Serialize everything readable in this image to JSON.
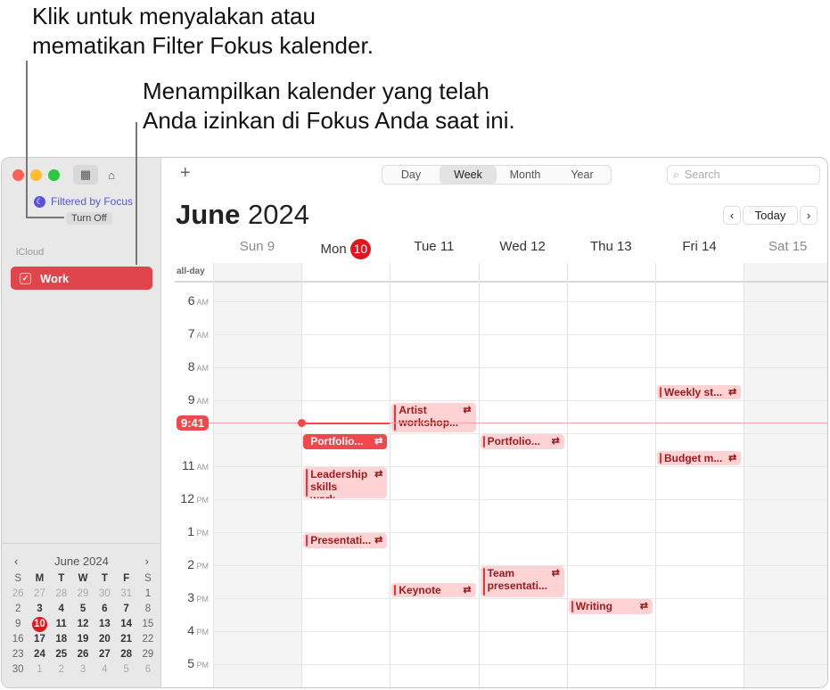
{
  "callouts": [
    "Klik untuk menyalakan atau",
    "mematikan Filter Fokus kalender.",
    "Menampilkan kalender yang telah",
    "Anda izinkan di Fokus Anda saat ini."
  ],
  "sidebar": {
    "focus_label": "Filtered by Focus",
    "turn_off": "Turn Off",
    "group": "iCloud",
    "calendars": [
      {
        "label": "Work",
        "checked": true,
        "color": "#e0454b"
      }
    ]
  },
  "mini_calendar": {
    "title": "June 2024",
    "weekdays": [
      "S",
      "M",
      "T",
      "W",
      "T",
      "F",
      "S"
    ],
    "weeks": [
      [
        "26",
        "27",
        "28",
        "29",
        "30",
        "31",
        "1"
      ],
      [
        "2",
        "3",
        "4",
        "5",
        "6",
        "7",
        "8"
      ],
      [
        "9",
        "10",
        "11",
        "12",
        "13",
        "14",
        "15"
      ],
      [
        "16",
        "17",
        "18",
        "19",
        "20",
        "21",
        "22"
      ],
      [
        "23",
        "24",
        "25",
        "26",
        "27",
        "28",
        "29"
      ],
      [
        "30",
        "1",
        "2",
        "3",
        "4",
        "5",
        "6"
      ]
    ],
    "today": "10"
  },
  "toolbar": {
    "views": [
      "Day",
      "Week",
      "Month",
      "Year"
    ],
    "active_view": "Week",
    "search_placeholder": "Search",
    "today": "Today"
  },
  "header": {
    "month": "June",
    "year": "2024"
  },
  "days": [
    {
      "name": "Sun",
      "num": "9"
    },
    {
      "name": "Mon",
      "num": "10",
      "today": true
    },
    {
      "name": "Tue",
      "num": "11"
    },
    {
      "name": "Wed",
      "num": "12"
    },
    {
      "name": "Thu",
      "num": "13"
    },
    {
      "name": "Fri",
      "num": "14"
    },
    {
      "name": "Sat",
      "num": "15"
    }
  ],
  "all_day_label": "all-day",
  "hours": [
    {
      "h": "6",
      "ap": "AM"
    },
    {
      "h": "7",
      "ap": "AM"
    },
    {
      "h": "8",
      "ap": "AM"
    },
    {
      "h": "9",
      "ap": "AM"
    },
    {
      "h": "10",
      "ap": "AM"
    },
    {
      "h": "11",
      "ap": "AM"
    },
    {
      "h": "12",
      "ap": "PM"
    },
    {
      "h": "1",
      "ap": "PM"
    },
    {
      "h": "2",
      "ap": "PM"
    },
    {
      "h": "3",
      "ap": "PM"
    },
    {
      "h": "4",
      "ap": "PM"
    },
    {
      "h": "5",
      "ap": "PM"
    }
  ],
  "current_time": "9:41",
  "events": [
    {
      "title": "Weekly st...",
      "day": 5,
      "start": 8.5,
      "end": 9.0
    },
    {
      "title": "Artist workshop...",
      "day": 2,
      "start": 9.05,
      "end": 10.0
    },
    {
      "title": "Portfolio...",
      "day": 1,
      "start": 10.0,
      "end": 10.5,
      "selected": true
    },
    {
      "title": "Portfolio...",
      "day": 3,
      "start": 10.0,
      "end": 10.5
    },
    {
      "title": "Budget m...",
      "day": 5,
      "start": 10.5,
      "end": 11.0
    },
    {
      "title": "Leadership skills work...",
      "day": 1,
      "start": 11.0,
      "end": 12.0
    },
    {
      "title": "Presentati...",
      "day": 1,
      "start": 13.0,
      "end": 13.5
    },
    {
      "title": "Team presentati...",
      "day": 3,
      "start": 14.0,
      "end": 15.0
    },
    {
      "title": "Keynote b...",
      "day": 2,
      "start": 14.5,
      "end": 15.0
    },
    {
      "title": "Writing se...",
      "day": 4,
      "start": 15.0,
      "end": 15.5
    }
  ],
  "colors": {
    "accent": "#e0161f",
    "event_bg": "#ffd3d3",
    "event_text": "#9a1a1e",
    "focus": "#5856d6"
  }
}
